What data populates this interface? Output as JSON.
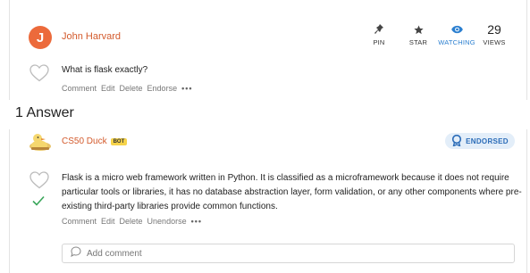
{
  "question": {
    "author": "John Harvard",
    "avatar_initial": "J",
    "text": "What is flask exactly?",
    "stats": {
      "pin_label": "PIN",
      "star_label": "STAR",
      "watching_label": "WATCHING",
      "views_count": "29",
      "views_label": "VIEWS"
    },
    "actions": [
      "Comment",
      "Edit",
      "Delete",
      "Endorse",
      "•••"
    ]
  },
  "answers_heading": "1 Answer",
  "answer": {
    "author": "CS50 Duck",
    "badge": "BOT",
    "endorsed_label": "ENDORSED",
    "text": "Flask is a micro web framework written in Python. It is classified as a microframework because it does not require particular tools or libraries, it has no database abstraction layer, form validation, or any other components where pre-existing third-party libraries provide common functions.",
    "actions": [
      "Comment",
      "Edit",
      "Delete",
      "Unendorse",
      "•••"
    ]
  },
  "comment_box": {
    "placeholder": "Add comment"
  },
  "colors": {
    "accent_orange": "#d35a2c",
    "avatar_orange": "#ec6a3b",
    "watching_blue": "#2b7fd0",
    "endorsed_bg": "#e3eef9",
    "check_green": "#3aa65a"
  },
  "icons": [
    "pin-icon",
    "star-icon",
    "eye-icon",
    "heart-icon",
    "check-icon",
    "award-icon",
    "comment-icon",
    "duck-avatar"
  ]
}
